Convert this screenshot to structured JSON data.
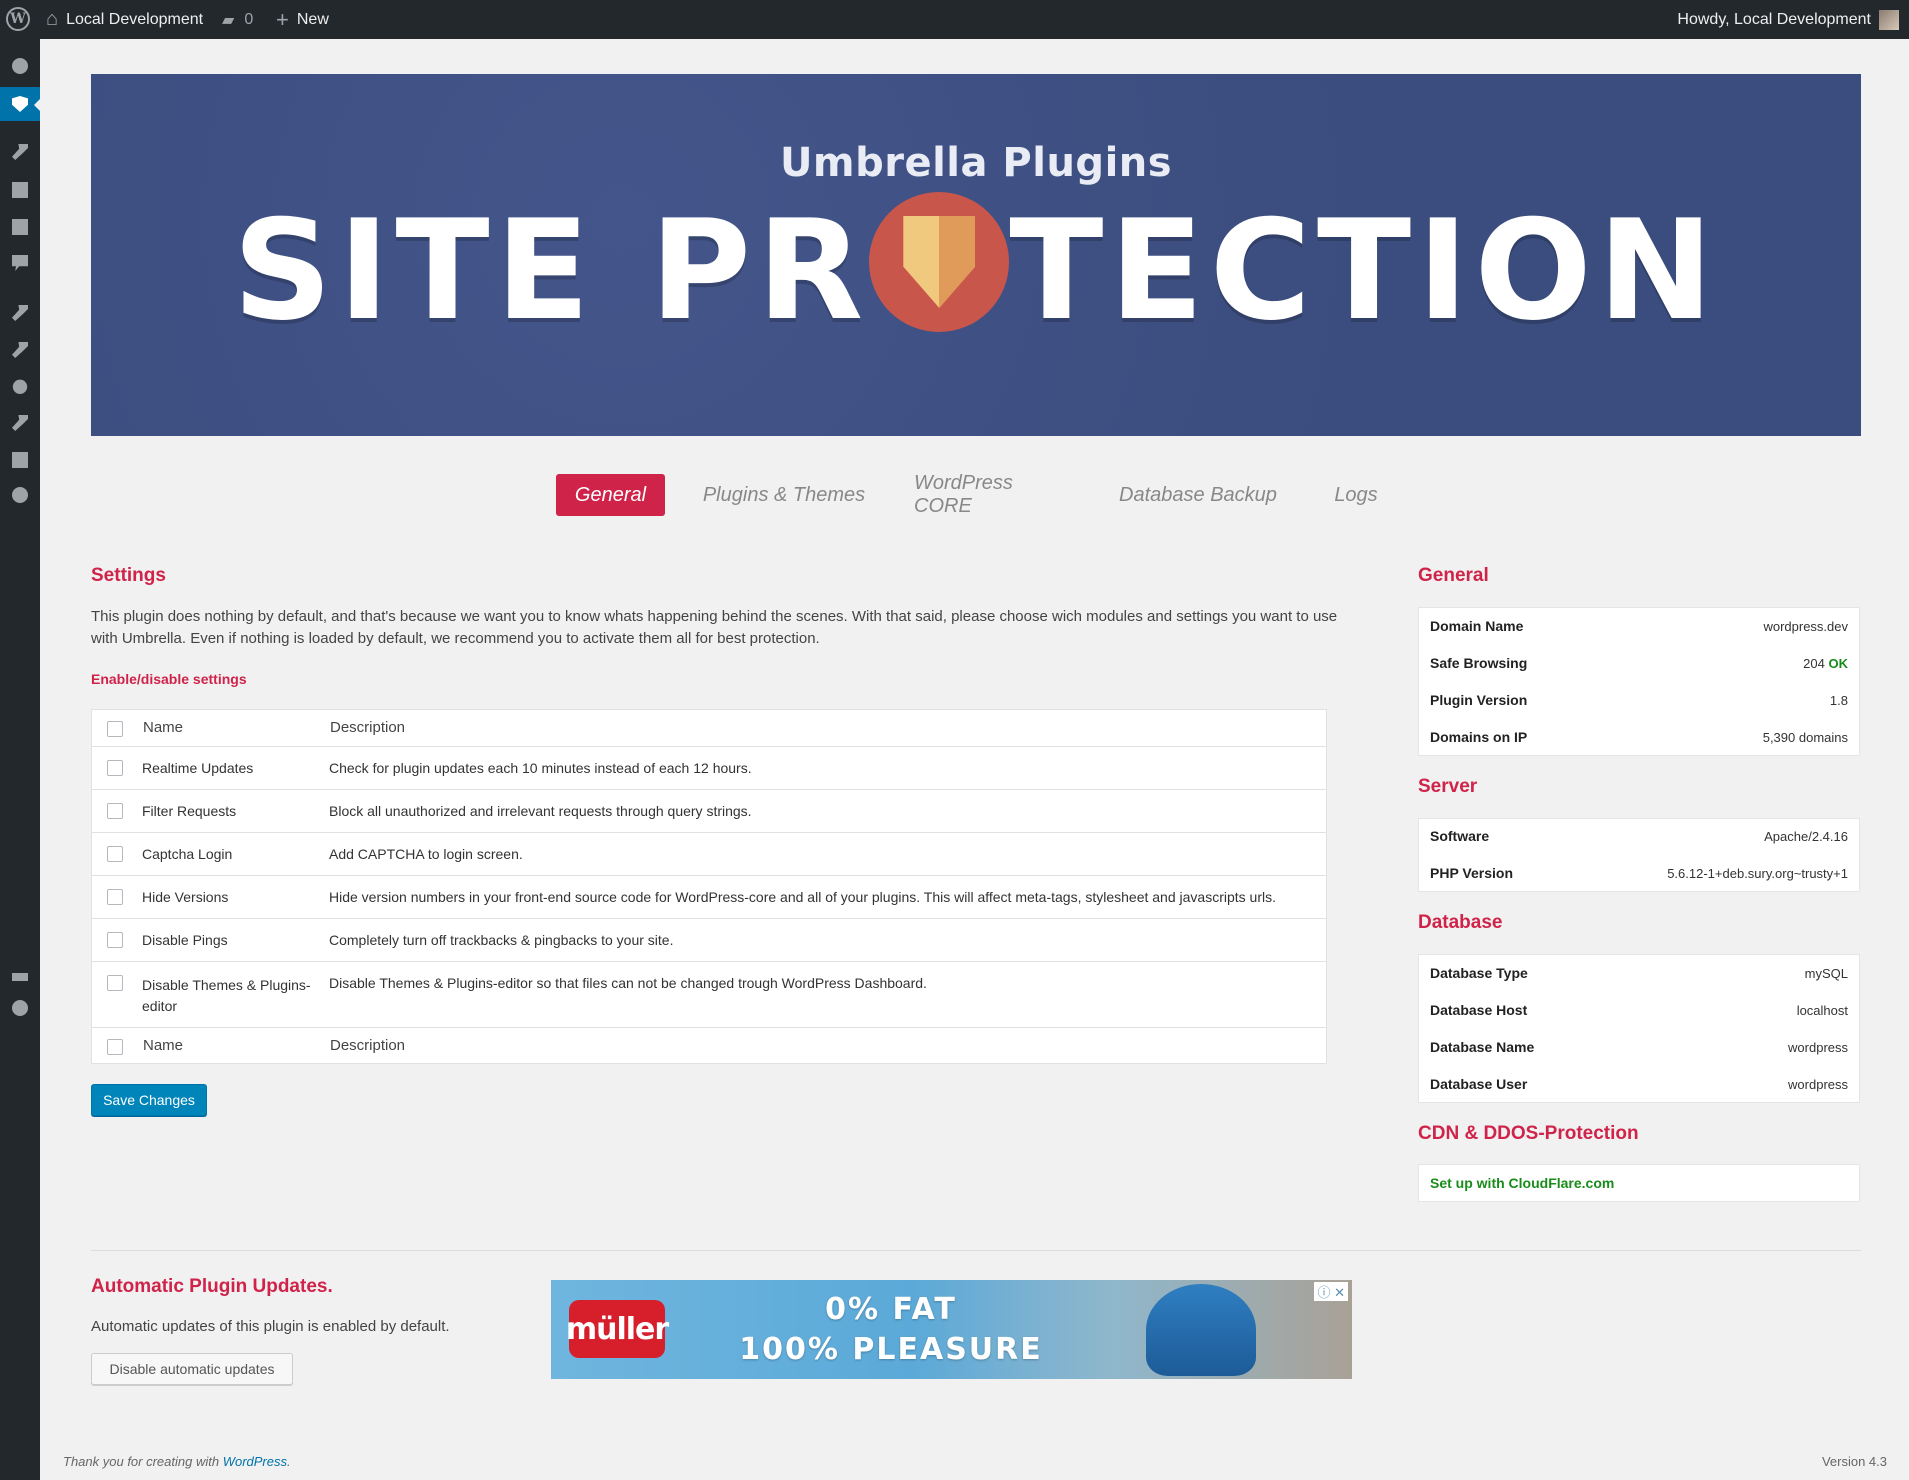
{
  "adminbar": {
    "site_name": "Local Development",
    "comments_count": "0",
    "new_label": "New",
    "howdy": "Howdy, Local Development"
  },
  "banner": {
    "subtitle": "Umbrella Plugins",
    "title_left": "SITE PR",
    "title_right": "TECTION"
  },
  "tabs": [
    {
      "label": "General"
    },
    {
      "label": "Plugins & Themes"
    },
    {
      "label": "WordPress CORE"
    },
    {
      "label": "Database Backup"
    },
    {
      "label": "Logs"
    }
  ],
  "settings": {
    "heading": "Settings",
    "intro": "This plugin does nothing by default, and that's because we want you to know whats happening behind the scenes. With that said, please choose wich modules and settings you want to use with Umbrella. Even if nothing is loaded by default, we recommend you to activate them all for best protection.",
    "toggle_label": "Enable/disable settings",
    "col_name": "Name",
    "col_description": "Description",
    "rows": [
      {
        "name": "Realtime Updates",
        "description": "Check for plugin updates each 10 minutes instead of each 12 hours."
      },
      {
        "name": "Filter Requests",
        "description": "Block all unauthorized and irrelevant requests through query strings."
      },
      {
        "name": "Captcha Login",
        "description": "Add CAPTCHA to login screen."
      },
      {
        "name": "Hide Versions",
        "description": "Hide version numbers in your front-end source code for WordPress-core and all of your plugins. This will affect meta-tags, stylesheet and javascripts urls."
      },
      {
        "name": "Disable Pings",
        "description": "Completely turn off trackbacks & pingbacks to your site."
      },
      {
        "name": "Disable Themes & Plugins-editor",
        "description": "Disable Themes & Plugins-editor so that files can not be changed trough WordPress Dashboard."
      }
    ],
    "save_label": "Save Changes"
  },
  "general": {
    "heading": "General",
    "rows": [
      {
        "key": "Domain Name",
        "value": "wordpress.dev"
      },
      {
        "key": "Safe Browsing",
        "value": "204",
        "status": "OK"
      },
      {
        "key": "Plugin Version",
        "value": "1.8"
      },
      {
        "key": "Domains on IP",
        "value": "5,390 domains"
      }
    ]
  },
  "server": {
    "heading": "Server",
    "rows": [
      {
        "key": "Software",
        "value": "Apache/2.4.16"
      },
      {
        "key": "PHP Version",
        "value": "5.6.12-1+deb.sury.org~trusty+1"
      }
    ]
  },
  "database": {
    "heading": "Database",
    "rows": [
      {
        "key": "Database Type",
        "value": "mySQL"
      },
      {
        "key": "Database Host",
        "value": "localhost"
      },
      {
        "key": "Database Name",
        "value": "wordpress"
      },
      {
        "key": "Database User",
        "value": "wordpress"
      }
    ]
  },
  "cdn": {
    "heading": "CDN & DDOS-Protection",
    "link": "Set up with CloudFlare.com"
  },
  "auto_updates": {
    "heading": "Automatic Plugin Updates.",
    "text": "Automatic updates of this plugin is enabled by default.",
    "button": "Disable automatic updates"
  },
  "ad": {
    "brand": "müller",
    "line1": "0% FAT",
    "line2": "100% PLEASURE",
    "choices": "ⓘ ✕"
  },
  "footer": {
    "thanks_prefix": "Thank you for creating with ",
    "thanks_link": "WordPress",
    "thanks_suffix": ".",
    "version": "Version 4.3"
  },
  "colors": {
    "accent": "#d0234a",
    "admin_bar": "#23282d",
    "primary_button": "#0085ba",
    "ok": "#1a8c1a"
  }
}
